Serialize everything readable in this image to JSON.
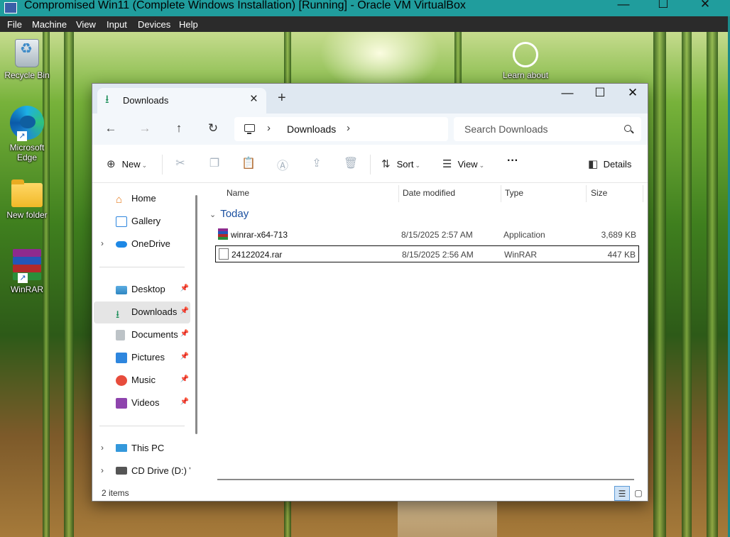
{
  "vbox": {
    "title": "Compromised Win11 (Complete Windows Installation) [Running] - Oracle VM VirtualBox",
    "menu": [
      "File",
      "Machine",
      "View",
      "Input",
      "Devices",
      "Help"
    ]
  },
  "desktop": {
    "icons": [
      {
        "label": "Recycle Bin",
        "icon": "recycle-bin-icon"
      },
      {
        "label": "Microsoft Edge",
        "icon": "edge-icon"
      },
      {
        "label": "New folder",
        "icon": "folder-icon"
      },
      {
        "label": "WinRAR",
        "icon": "winrar-icon"
      }
    ],
    "learn_about": "Learn about"
  },
  "explorer": {
    "tab_title": "Downloads",
    "breadcrumb": "Downloads",
    "search_placeholder": "Search Downloads",
    "toolbar": {
      "new_label": "New",
      "sort_label": "Sort",
      "view_label": "View",
      "more_label": "···",
      "details_label": "Details"
    },
    "sidebar": {
      "top": [
        {
          "label": "Home",
          "icon": "home-icon",
          "color": "#e67e22"
        },
        {
          "label": "Gallery",
          "icon": "gallery-icon",
          "color": "#2e86de"
        },
        {
          "label": "OneDrive",
          "icon": "cloud-icon",
          "color": "#1e88e5"
        }
      ],
      "quick": [
        {
          "label": "Desktop",
          "icon": "desktop-icon",
          "color": "#3498db"
        },
        {
          "label": "Downloads",
          "icon": "download-icon",
          "color": "#1d8f5a"
        },
        {
          "label": "Documents",
          "icon": "documents-icon",
          "color": "#7f8c8d"
        },
        {
          "label": "Pictures",
          "icon": "pictures-icon",
          "color": "#2e86de"
        },
        {
          "label": "Music",
          "icon": "music-icon",
          "color": "#e74c3c"
        },
        {
          "label": "Videos",
          "icon": "videos-icon",
          "color": "#8e44ad"
        }
      ],
      "devices": [
        {
          "label": "This PC",
          "icon": "computer-icon",
          "color": "#3498db"
        },
        {
          "label": "CD Drive (D:) Vir",
          "icon": "cd-drive-icon",
          "color": "#555555"
        }
      ]
    },
    "columns": {
      "name": "Name",
      "date": "Date modified",
      "type": "Type",
      "size": "Size"
    },
    "group": "Today",
    "files": [
      {
        "name": "winrar-x64-713",
        "date": "8/15/2025 2:57 AM",
        "type": "Application",
        "size": "3,689 KB",
        "icon": "winrar-installer-icon"
      },
      {
        "name": "24122024.rar",
        "date": "8/15/2025 2:56 AM",
        "type": "WinRAR",
        "size": "447 KB",
        "icon": "archive-file-icon"
      }
    ],
    "status": "2 items"
  }
}
